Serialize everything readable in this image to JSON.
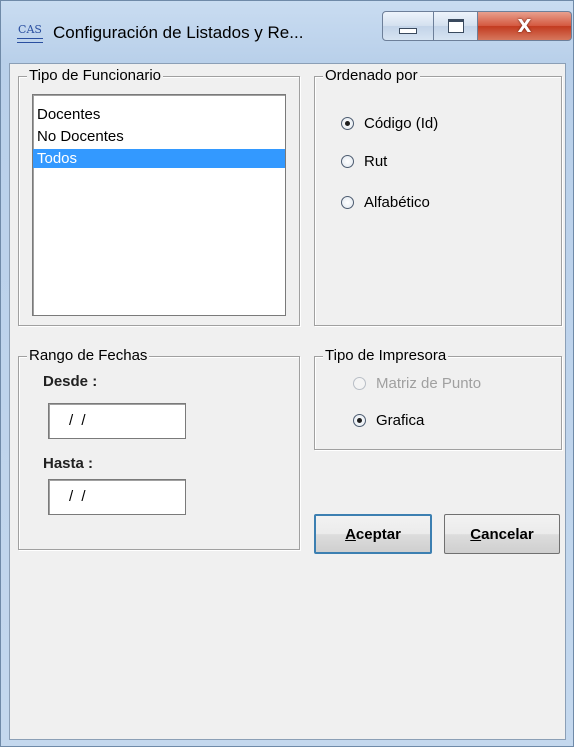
{
  "window": {
    "title": "Configuración de Listados y Re...",
    "icon_text": "CAS",
    "close_glyph": "X"
  },
  "tipo_funcionario": {
    "legend": "Tipo de Funcionario",
    "items": [
      "Docentes",
      "No Docentes",
      "Todos"
    ],
    "selected": "Todos"
  },
  "ordenado_por": {
    "legend": "Ordenado por",
    "options": [
      {
        "label": "Código (Id)",
        "checked": true
      },
      {
        "label": "Rut",
        "checked": false
      },
      {
        "label": "Alfabético",
        "checked": false
      }
    ]
  },
  "rango_fechas": {
    "legend": "Rango de Fechas",
    "desde_label": "Desde :",
    "desde_value": "/ /",
    "hasta_label": "Hasta :",
    "hasta_value": "/ /"
  },
  "tipo_impresora": {
    "legend": "Tipo de Impresora",
    "options": [
      {
        "label": "Matriz de Punto",
        "checked": false,
        "disabled": true
      },
      {
        "label": "Grafica",
        "checked": true,
        "disabled": false
      }
    ]
  },
  "buttons": {
    "aceptar_first": "A",
    "aceptar_rest": "ceptar",
    "cancelar_first": "C",
    "cancelar_rest": "ancelar"
  },
  "colors": {
    "selection": "#3399ff",
    "close_button": "#c23a1f",
    "default_button_border": "#3c7fb1"
  }
}
